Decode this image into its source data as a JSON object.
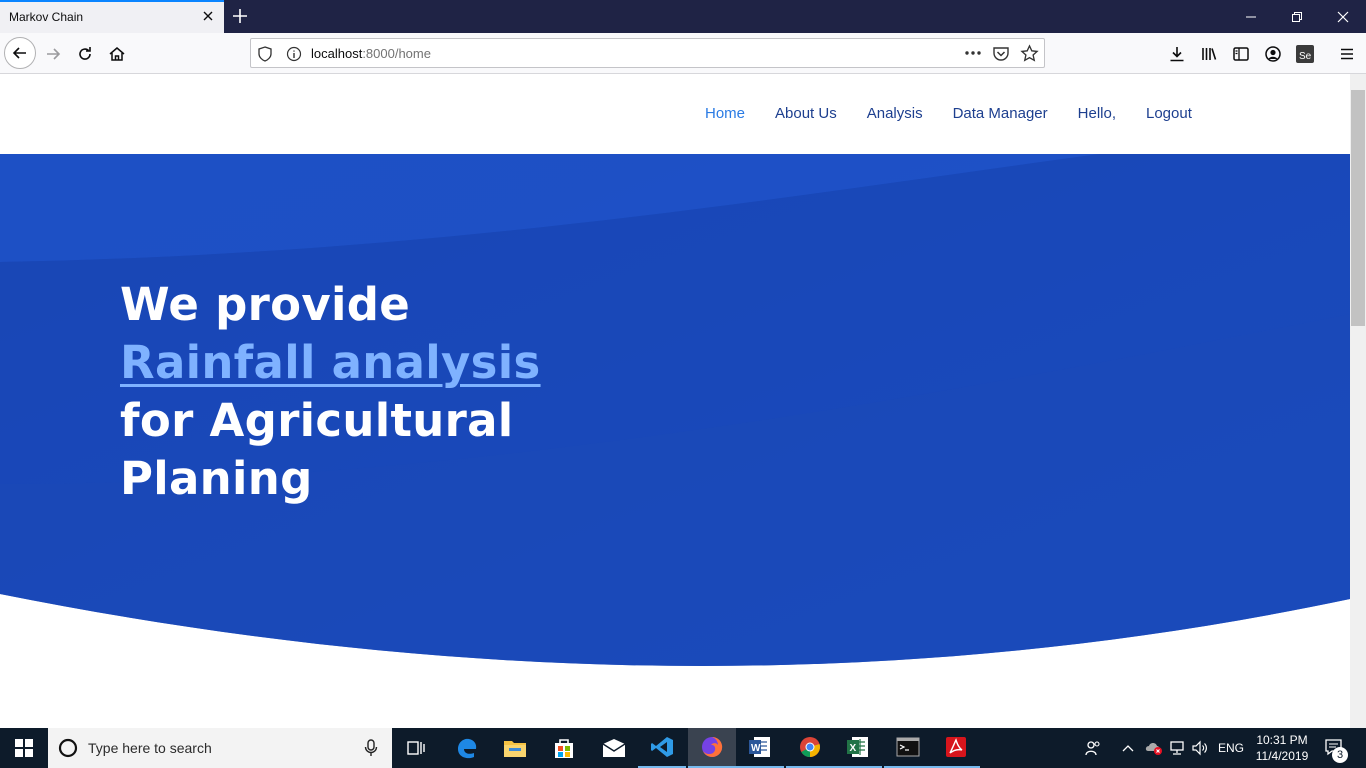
{
  "browser": {
    "tab_title": "Markov Chain",
    "url_host": "localhost",
    "url_path": ":8000/home"
  },
  "site": {
    "menu": [
      {
        "label": "Home"
      },
      {
        "label": "About Us"
      },
      {
        "label": "Analysis"
      },
      {
        "label": "Data Manager"
      },
      {
        "label": "Hello,"
      },
      {
        "label": "Logout"
      }
    ],
    "hero": {
      "line1": "We provide",
      "highlight": "Rainfall analysis",
      "line3": "for Agricultural",
      "line4": "Planing"
    }
  },
  "taskbar": {
    "search_placeholder": "Type here to search",
    "language": "ENG",
    "time": "10:31 PM",
    "date": "11/4/2019",
    "notifications": "3"
  },
  "colors": {
    "hero_blue": "#1b4bbf",
    "hero_highlight": "#7fb2ff",
    "nav_link": "#1d3f8f",
    "nav_active": "#2a7be4"
  }
}
